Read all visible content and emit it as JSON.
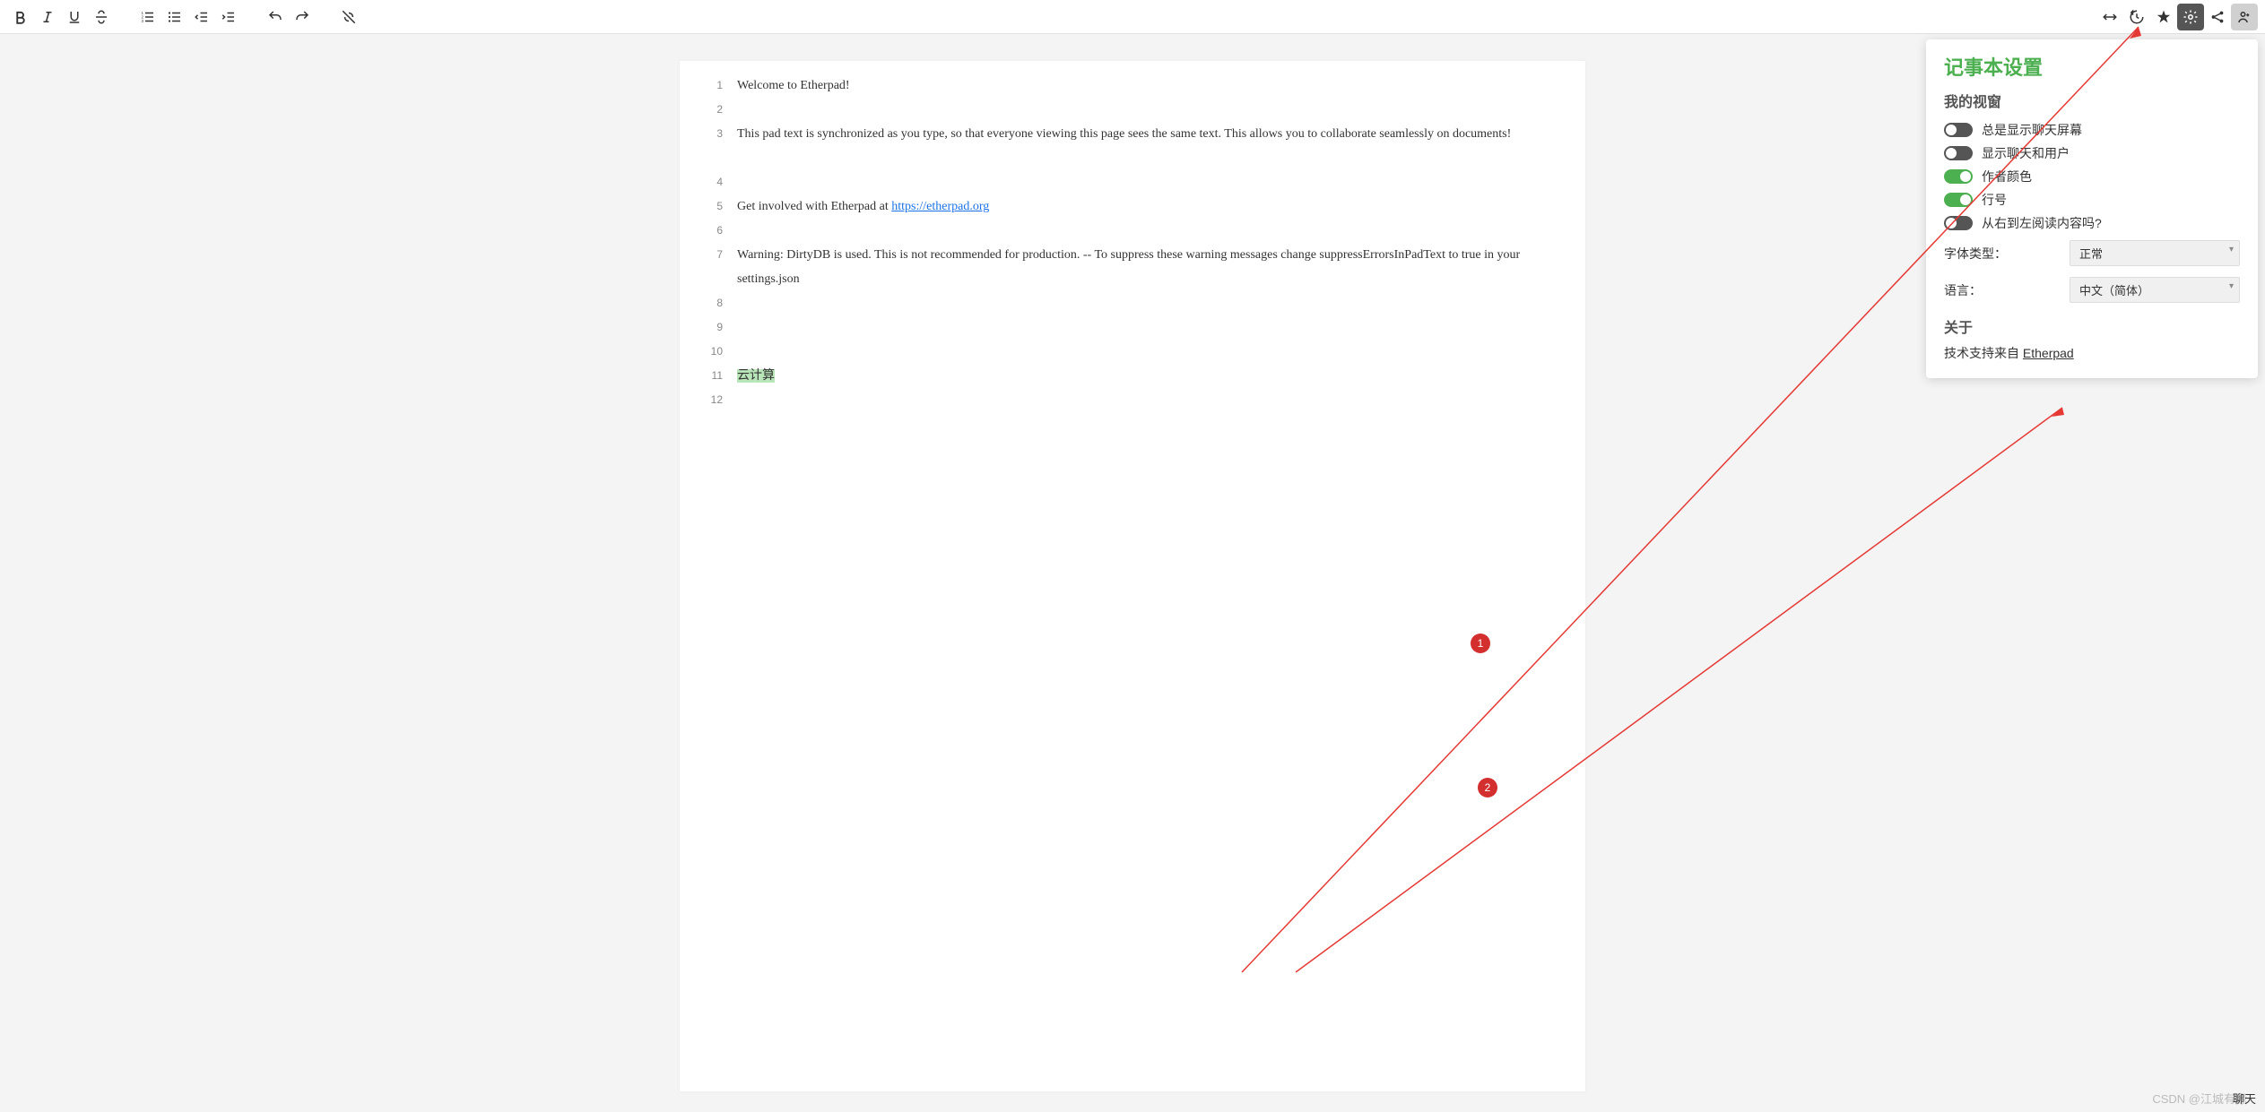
{
  "toolbar": {
    "left_groups": [
      [
        "bold",
        "italic",
        "underline",
        "strike"
      ],
      [
        "list-ordered",
        "list-bullet",
        "outdent",
        "indent"
      ],
      [
        "undo",
        "redo"
      ],
      [
        "clear-format"
      ]
    ],
    "right_items": [
      "import-export",
      "timeslider",
      "star",
      "settings",
      "share",
      "users"
    ]
  },
  "gutter_lines": [
    "1",
    "2",
    "3",
    "",
    "4",
    "5",
    "6",
    "7",
    "",
    "8",
    "9",
    "10",
    "11",
    "12"
  ],
  "content": {
    "line1": "Welcome to Etherpad!",
    "line3": "This pad text is synchronized as you type, so that everyone viewing this page sees the same text. This allows you to collaborate seamlessly on documents!",
    "line5a": "Get involved with Etherpad at ",
    "line5_link": "https://etherpad.org",
    "line7": "Warning: DirtyDB is used. This is not recommended for production. -- To suppress these warning messages change suppressErrorsInPadText to true in your settings.json",
    "line11": "云计算"
  },
  "settings": {
    "title": "记事本设置",
    "section_view": "我的视窗",
    "toggles": [
      {
        "label": "总是显示聊天屏幕",
        "on": false
      },
      {
        "label": "显示聊天和用户",
        "on": false
      },
      {
        "label": "作者颜色",
        "on": true
      },
      {
        "label": "行号",
        "on": true
      },
      {
        "label": "从右到左阅读内容吗?",
        "on": false
      }
    ],
    "font_label": "字体类型：",
    "font_value": "正常",
    "lang_label": "语言：",
    "lang_value": "中文（简体）",
    "about_title": "关于",
    "about_text": "技术支持来自 ",
    "about_link": "Etherpad"
  },
  "annotations": {
    "badge1": "1",
    "badge2": "2"
  },
  "watermark": "CSDN @江城有缘",
  "chat_label": "聊天"
}
